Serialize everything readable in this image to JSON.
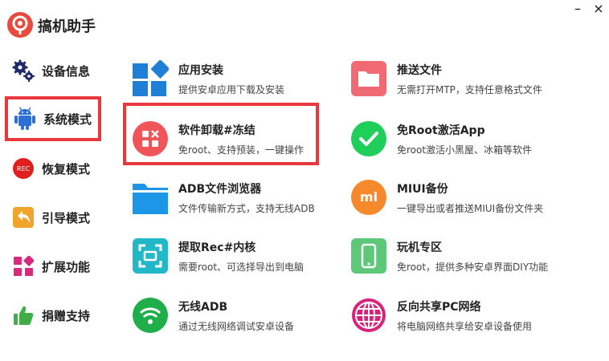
{
  "app": {
    "title": "搞机助手"
  },
  "window": {
    "minimize_glyph": "–",
    "close_glyph": "×"
  },
  "colors": {
    "accent_red": "#e8383d"
  },
  "sidebar": {
    "items": [
      {
        "label": "设备信息",
        "icon": "gears-icon"
      },
      {
        "label": "系统模式",
        "icon": "android-icon",
        "selected": true
      },
      {
        "label": "恢复模式",
        "icon": "rec-icon",
        "icon_text": "REC"
      },
      {
        "label": "引导模式",
        "icon": "back-arrow-icon"
      },
      {
        "label": "扩展功能",
        "icon": "grid-icon"
      },
      {
        "label": "捐赠支持",
        "icon": "thumbs-up-icon"
      }
    ]
  },
  "features": {
    "left": [
      {
        "title": "应用安装",
        "desc": "提供安卓应用下载及安装",
        "icon": "apps-icon"
      },
      {
        "title": "软件卸载#冻结",
        "desc": "免root、支持预装，一键操作",
        "icon": "uninstall-icon"
      },
      {
        "title": "ADB文件浏览器",
        "desc": "文件传输新方式，支持无线ADB",
        "icon": "folder-blue-icon"
      },
      {
        "title": "提取Rec#内核",
        "desc": "需要root、可选择导出到电脑",
        "icon": "scan-icon"
      },
      {
        "title": "无线ADB",
        "desc": "通过无线网络调试安卓设备",
        "icon": "wifi-icon"
      }
    ],
    "right": [
      {
        "title": "推送文件",
        "desc": "无需打开MTP，支持任意格式文件",
        "icon": "folder-pink-icon"
      },
      {
        "title": "免Root激活App",
        "desc": "免root激活小黑屋、冰箱等软件",
        "icon": "check-icon"
      },
      {
        "title": "MIUI备份",
        "desc": "一键导出或者推送MIUI备份文件夹",
        "icon": "mi-icon",
        "icon_text": "mi"
      },
      {
        "title": "玩机专区",
        "desc": "免root，提供多种安卓界面DIY功能",
        "icon": "phone-icon"
      },
      {
        "title": "反向共享PC网络",
        "desc": "将电脑网络共享给安卓设备使用",
        "icon": "globe-icon"
      }
    ]
  }
}
